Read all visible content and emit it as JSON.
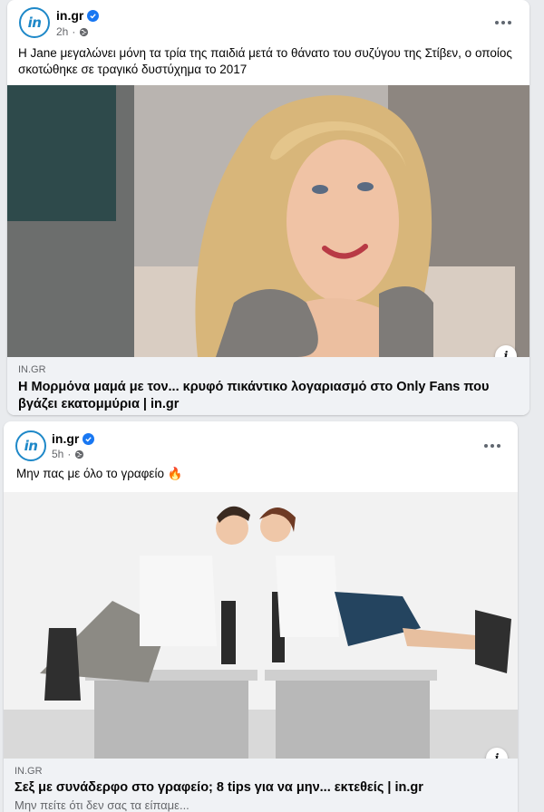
{
  "posts": [
    {
      "page_name": "in.gr",
      "avatar_text": "in",
      "time": "2h",
      "text": "Η Jane μεγαλώνει μόνη τα τρία της παιδιά μετά το θάνατο του συζύγου της Στίβεν, ο οποίος σκοτώθηκε σε τραγικό δυστύχημα το 2017",
      "link_domain": "IN.GR",
      "link_title": "Η Μορμόνα μαμά με τον... κρυφό πικάντικο λογαριασμό στο Only Fans που βγάζει εκατομμύρια | in.gr",
      "link_desc": "",
      "info_icon": "i"
    },
    {
      "page_name": "in.gr",
      "avatar_text": "in",
      "time": "5h",
      "text": "Μην πας με όλο το γραφείο 🔥",
      "link_domain": "IN.GR",
      "link_title": "Σεξ με συνάδερφο στο γραφείο; 8 tips για να μην... εκτεθείς | in.gr",
      "link_desc": "Μην πείτε ότι δεν σας τα είπαμε...",
      "info_icon": "i"
    }
  ],
  "icons": {
    "verified": "verified-badge-icon",
    "globe": "globe-icon",
    "more": "more-options-icon",
    "info": "info-icon"
  },
  "colors": {
    "brand": "#1e88c8",
    "verified": "#1877f2",
    "secondary_text": "#65676b",
    "preview_bg": "#f0f2f5"
  }
}
